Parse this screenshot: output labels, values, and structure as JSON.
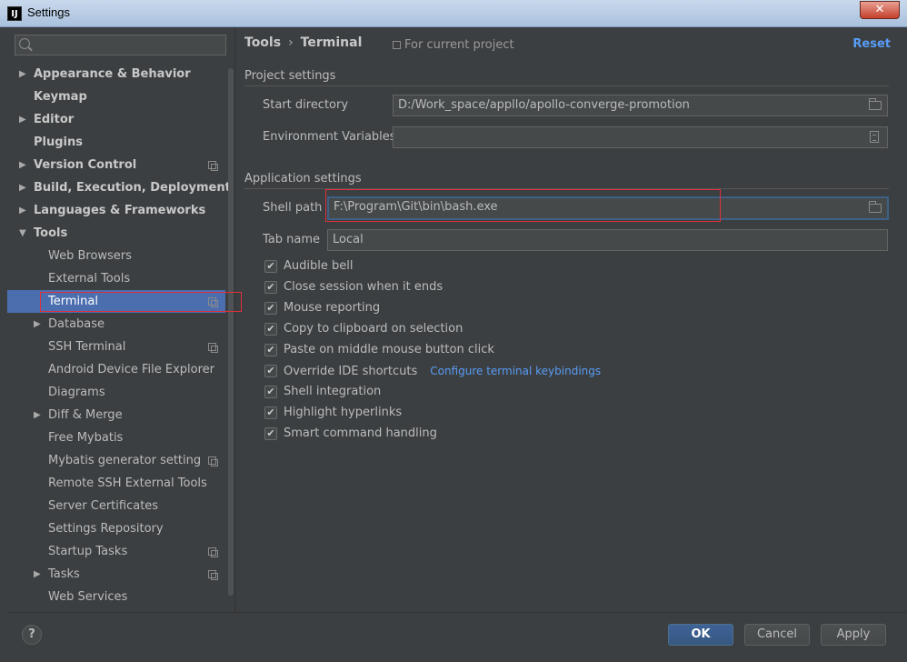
{
  "window": {
    "title": "Settings",
    "app_icon_text": "IJ",
    "close_label": "✕"
  },
  "sidebar": {
    "search": {
      "placeholder": ""
    },
    "items": [
      {
        "label": "Appearance & Behavior",
        "level": 0,
        "arrow": "▶",
        "project": false
      },
      {
        "label": "Keymap",
        "level": 0,
        "arrow": "",
        "project": false
      },
      {
        "label": "Editor",
        "level": 0,
        "arrow": "▶",
        "project": false
      },
      {
        "label": "Plugins",
        "level": 0,
        "arrow": "",
        "project": false
      },
      {
        "label": "Version Control",
        "level": 0,
        "arrow": "▶",
        "project": true
      },
      {
        "label": "Build, Execution, Deployment",
        "level": 0,
        "arrow": "▶",
        "project": false
      },
      {
        "label": "Languages & Frameworks",
        "level": 0,
        "arrow": "▶",
        "project": false
      },
      {
        "label": "Tools",
        "level": 0,
        "arrow": "▼",
        "project": false
      },
      {
        "label": "Web Browsers",
        "level": 1,
        "arrow": "",
        "project": false
      },
      {
        "label": "External Tools",
        "level": 1,
        "arrow": "",
        "project": false
      },
      {
        "label": "Terminal",
        "level": 1,
        "arrow": "",
        "project": true,
        "selected": true
      },
      {
        "label": "Database",
        "level": 1,
        "arrow": "▶",
        "project": false
      },
      {
        "label": "SSH Terminal",
        "level": 1,
        "arrow": "",
        "project": true
      },
      {
        "label": "Android Device File Explorer",
        "level": 1,
        "arrow": "",
        "project": false
      },
      {
        "label": "Diagrams",
        "level": 1,
        "arrow": "",
        "project": false
      },
      {
        "label": "Diff & Merge",
        "level": 1,
        "arrow": "▶",
        "project": false
      },
      {
        "label": "Free Mybatis",
        "level": 1,
        "arrow": "",
        "project": false
      },
      {
        "label": "Mybatis generator setting",
        "level": 1,
        "arrow": "",
        "project": true
      },
      {
        "label": "Remote SSH External Tools",
        "level": 1,
        "arrow": "",
        "project": false
      },
      {
        "label": "Server Certificates",
        "level": 1,
        "arrow": "",
        "project": false
      },
      {
        "label": "Settings Repository",
        "level": 1,
        "arrow": "",
        "project": false
      },
      {
        "label": "Startup Tasks",
        "level": 1,
        "arrow": "",
        "project": true
      },
      {
        "label": "Tasks",
        "level": 1,
        "arrow": "▶",
        "project": true
      },
      {
        "label": "Web Services",
        "level": 1,
        "arrow": "",
        "project": false
      }
    ]
  },
  "header": {
    "breadcrumb_parent": "Tools",
    "breadcrumb_sep": "›",
    "breadcrumb_current": "Terminal",
    "project_note": "For current project",
    "reset_label": "Reset"
  },
  "project_settings": {
    "title": "Project settings",
    "start_directory_label": "Start directory",
    "start_directory_value": "D:/Work_space/appllo/apollo-converge-promotion",
    "env_vars_label": "Environment Variables",
    "env_vars_value": ""
  },
  "application_settings": {
    "title": "Application settings",
    "shell_path_label": "Shell path",
    "shell_path_value": "F:\\Program\\Git\\bin\\bash.exe",
    "tab_name_label": "Tab name",
    "tab_name_value": "Local",
    "checkboxes": [
      {
        "label": "Audible bell",
        "checked": true
      },
      {
        "label": "Close session when it ends",
        "checked": true
      },
      {
        "label": "Mouse reporting",
        "checked": true
      },
      {
        "label": "Copy to clipboard on selection",
        "checked": true
      },
      {
        "label": "Paste on middle mouse button click",
        "checked": true
      },
      {
        "label": "Override IDE shortcuts",
        "checked": true,
        "link": "Configure terminal keybindings"
      },
      {
        "label": "Shell integration",
        "checked": true
      },
      {
        "label": "Highlight hyperlinks",
        "checked": true
      },
      {
        "label": "Smart command handling",
        "checked": true
      }
    ],
    "check_mark": "✔"
  },
  "footer": {
    "help_label": "?",
    "ok_label": "OK",
    "cancel_label": "Cancel",
    "apply_label": "Apply"
  },
  "colors": {
    "selection": "#4b6eaf",
    "link": "#589df6",
    "annotation": "#e0303a"
  }
}
